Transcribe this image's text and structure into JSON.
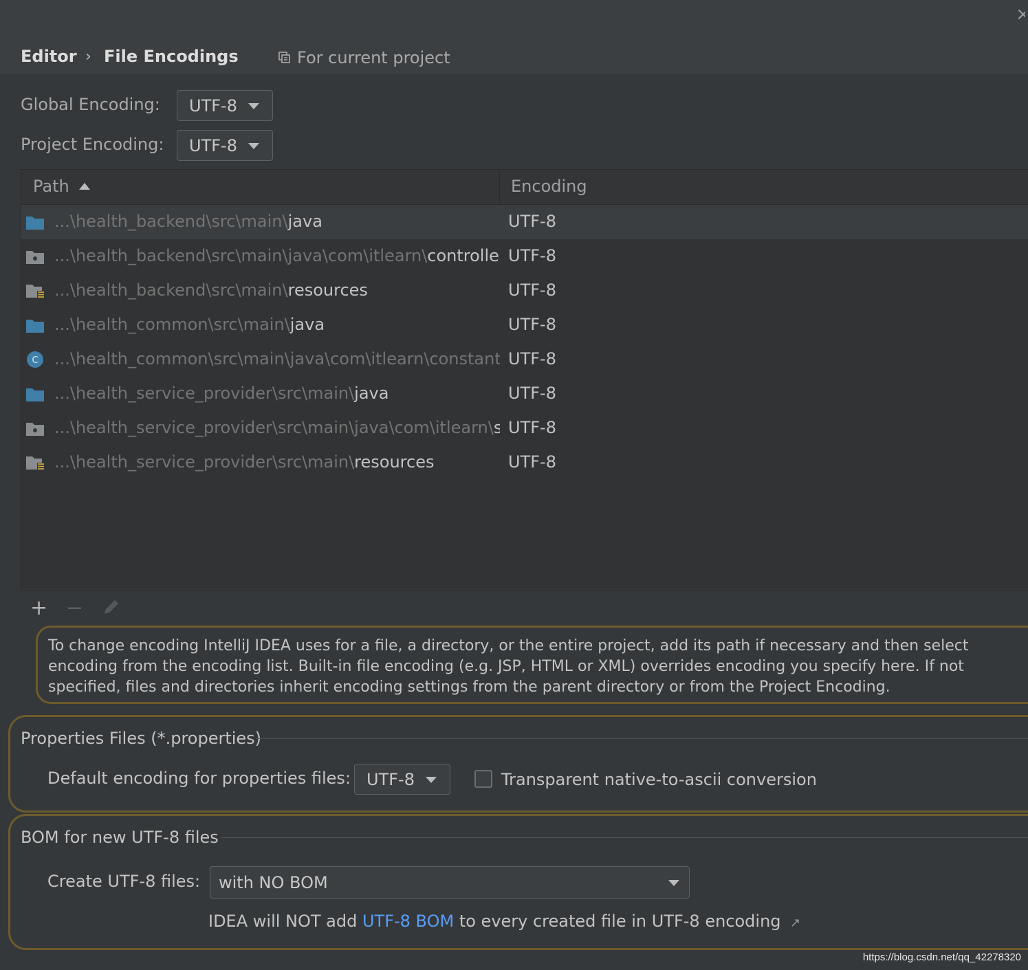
{
  "header": {
    "breadcrumb_parent": "Editor",
    "breadcrumb_sep": "›",
    "breadcrumb_current": "File Encodings",
    "scope_label": "For current project",
    "close_glyph": "×"
  },
  "encodings": {
    "global_label": "Global Encoding:",
    "global_value": "UTF-8",
    "project_label": "Project Encoding:",
    "project_value": "UTF-8"
  },
  "table": {
    "col_path": "Path",
    "col_encoding": "Encoding",
    "rows": [
      {
        "prefix": "...\\health_backend\\src\\main\\",
        "leaf": "java",
        "encoding": "UTF-8",
        "icon": "source-folder-icon"
      },
      {
        "prefix": "...\\health_backend\\src\\main\\java\\com\\itlearn\\",
        "leaf": "controller",
        "encoding": "UTF-8",
        "icon": "package-icon"
      },
      {
        "prefix": "...\\health_backend\\src\\main\\",
        "leaf": "resources",
        "encoding": "UTF-8",
        "icon": "resources-folder-icon"
      },
      {
        "prefix": "...\\health_common\\src\\main\\",
        "leaf": "java",
        "encoding": "UTF-8",
        "icon": "source-folder-icon"
      },
      {
        "prefix": "...\\health_common\\src\\main\\java\\com\\itlearn\\constant\\M",
        "leaf": "",
        "encoding": "UTF-8",
        "icon": "class-icon"
      },
      {
        "prefix": "...\\health_service_provider\\src\\main\\",
        "leaf": "java",
        "encoding": "UTF-8",
        "icon": "source-folder-icon"
      },
      {
        "prefix": "...\\health_service_provider\\src\\main\\java\\com\\itlearn\\",
        "leaf": "ser",
        "encoding": "UTF-8",
        "icon": "package-icon"
      },
      {
        "prefix": "...\\health_service_provider\\src\\main\\",
        "leaf": "resources",
        "encoding": "UTF-8",
        "icon": "resources-folder-icon"
      }
    ]
  },
  "toolbar": {
    "add": "+",
    "remove": "−"
  },
  "hint_text": "To change encoding IntelliJ IDEA uses for a file, a directory, or the entire project, add its path if necessary and then select encoding from the encoding list. Built-in file encoding (e.g. JSP, HTML or XML) overrides encoding you specify here. If not specified, files and directories inherit encoding settings from the parent directory or from the Project Encoding.",
  "properties": {
    "title": "Properties Files (*.properties)",
    "default_label": "Default encoding for properties files:",
    "default_value": "UTF-8",
    "transparent_label": "Transparent native-to-ascii conversion",
    "transparent_checked": false
  },
  "bom": {
    "title": "BOM for new UTF-8 files",
    "create_label": "Create UTF-8 files:",
    "create_value": "with NO BOM",
    "note_before": "IDEA will NOT add ",
    "note_link": "UTF-8 BOM",
    "note_after": " to every created file in UTF-8 encoding",
    "note_arrow": "↗"
  },
  "watermark": "https://blog.csdn.net/qq_42278320",
  "colors": {
    "accent_link": "#589df6",
    "highlight_border": "#6e5b2b",
    "folder_blue": "#3f7fa8"
  }
}
